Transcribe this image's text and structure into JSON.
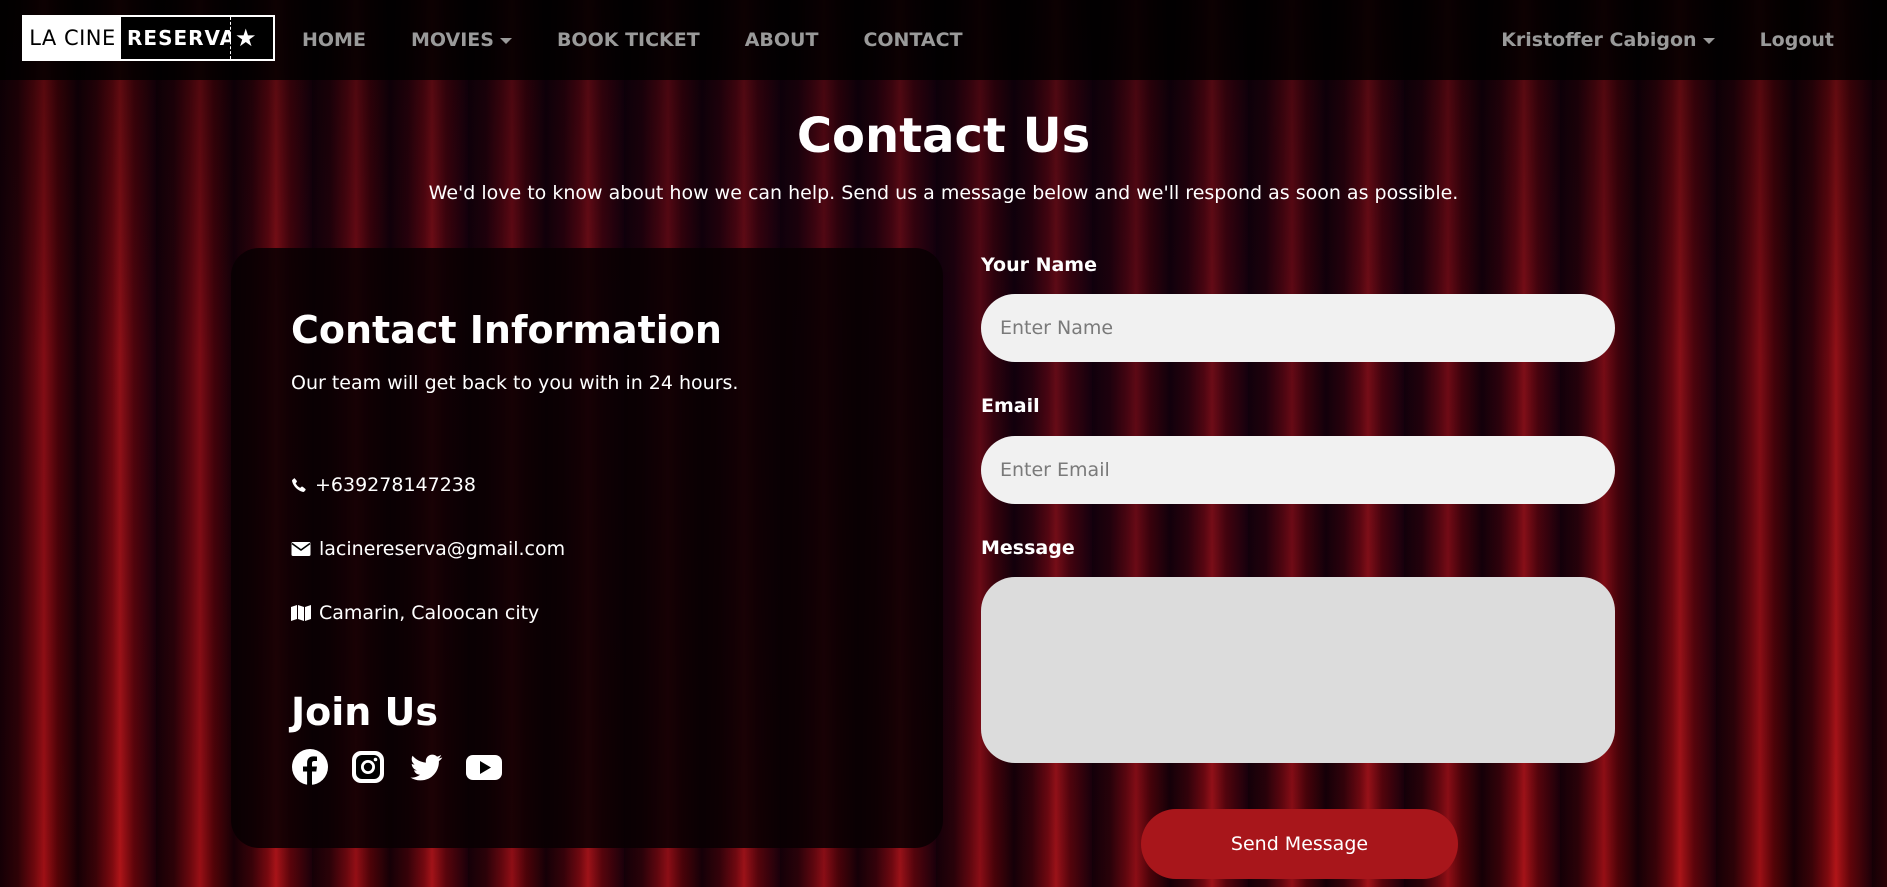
{
  "nav": {
    "logo_left": "LA CINE",
    "logo_right": "RESERVA",
    "logo_star": "★",
    "links": {
      "home": "HOME",
      "movies": "MOVIES",
      "book_ticket": "BOOK TICKET",
      "about": "ABOUT",
      "contact": "CONTACT"
    },
    "user_name": "Kristoffer Cabigon",
    "logout": "Logout"
  },
  "header": {
    "title": "Contact Us",
    "subtitle": "We'd love to know about how we can help. Send us a message below and we'll respond as soon as possible."
  },
  "info": {
    "title": "Contact Information",
    "subtitle": "Our team will get back to you with in 24 hours.",
    "phone": "+639278147238",
    "email": "lacinereserva@gmail.com",
    "address": "Camarin, Caloocan city",
    "join_title": "Join Us",
    "socials": [
      "facebook-icon",
      "instagram-icon",
      "twitter-icon",
      "youtube-icon"
    ]
  },
  "form": {
    "name_label": "Your Name",
    "name_placeholder": "Enter Name",
    "email_label": "Email",
    "email_placeholder": "Enter Email",
    "message_label": "Message",
    "send_label": "Send Message"
  },
  "colors": {
    "accent": "#a8161b",
    "nav_text": "#9a9a9a",
    "input_bg": "#f1f1f1"
  }
}
